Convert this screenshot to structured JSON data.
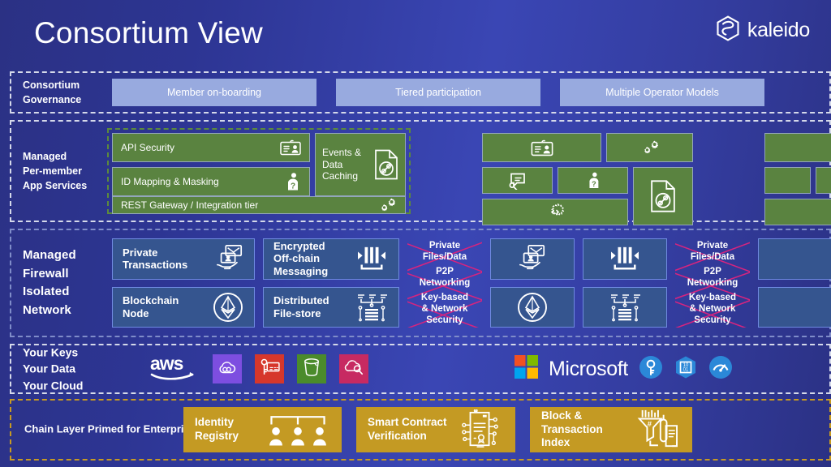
{
  "header": {
    "title": "Consortium View",
    "logo_text": "kaleido",
    "logo_icon": "kaleido-hexagon-icon"
  },
  "bands": {
    "governance": {
      "label": "Consortium\nGovernance",
      "chips": [
        {
          "label": "Member on-boarding"
        },
        {
          "label": "Tiered participation"
        },
        {
          "label": "Multiple Operator Models"
        }
      ],
      "chip_color": "#98aadf",
      "border_color": "#d5d9ea"
    },
    "app_services": {
      "label": "Managed\nPer-member\nApp Services",
      "border_color": "#5c8a3c",
      "card_color": "#5a8340",
      "member1": {
        "services": [
          {
            "label": "API Security",
            "icon": "id-badge-icon"
          },
          {
            "label": "ID Mapping & Masking",
            "icon": "person-key-icon"
          },
          {
            "label": "REST Gateway / Integration tier",
            "icon": "gears-icon"
          }
        ],
        "events": {
          "label": "Events &\nData\nCaching",
          "icon": "document-link-icon"
        }
      },
      "member2": {
        "tiles": [
          {
            "icon": "id-badge-icon"
          },
          {
            "icon": "gears-icon"
          },
          {
            "icon": "chat-key-icon"
          },
          {
            "icon": "person-key-icon"
          },
          {
            "icon": "gear-code-icon"
          },
          {
            "icon": "document-link-icon"
          }
        ]
      },
      "member3": {
        "tiles": [
          {
            "icon": "blank"
          },
          {
            "icon": "blank"
          },
          {
            "icon": "blank"
          },
          {
            "icon": "blank"
          }
        ]
      }
    },
    "firewall": {
      "label": "Managed\nFirewall\nIsolated\nNetwork",
      "border_color": "#7f8cc9",
      "card_color": "#35558f",
      "member1": [
        {
          "label": "Private\nTransactions",
          "icon": "private-transaction-icon"
        },
        {
          "label": "Blockchain\nNode",
          "icon": "ethereum-icon"
        },
        {
          "label": "Encrypted\nOff-chain\nMessaging",
          "icon": "barcode-messaging-icon"
        },
        {
          "label": "Distributed\nFile-store",
          "icon": "file-store-icon"
        }
      ],
      "crossed_out": {
        "lines": "Private\nFiles/Data",
        "lines2": "P2P\nNetworking",
        "lines3": "Key-based\n& Network\nSecurity",
        "strike_color": "#d6247f"
      },
      "member2": [
        {
          "icon": "private-transaction-icon"
        },
        {
          "icon": "ethereum-icon"
        },
        {
          "icon": "barcode-messaging-icon"
        },
        {
          "icon": "file-store-icon"
        }
      ]
    },
    "cloud": {
      "label": "Your Keys\nYour Data\nYour Cloud",
      "border_color": "#d5d9ea",
      "aws": {
        "wordmark": "aws",
        "tiles": [
          {
            "icon": "cloud-link-icon",
            "color": "#7d4ee0"
          },
          {
            "icon": "key-card-icon",
            "color": "#d6372b"
          },
          {
            "icon": "bucket-icon",
            "color": "#4b8b2b"
          },
          {
            "icon": "cloud-search-icon",
            "color": "#c72a62"
          }
        ]
      },
      "microsoft": {
        "wordmark": "Microsoft",
        "logo_colors": [
          "#f25022",
          "#7fba00",
          "#00a4ef",
          "#ffb900"
        ],
        "tiles": [
          {
            "icon": "azure-key-vault-icon",
            "color": "#2b88d8"
          },
          {
            "icon": "azure-blockchain-icon",
            "color": "#2b88d8"
          },
          {
            "icon": "azure-monitor-icon",
            "color": "#2b88d8"
          }
        ]
      }
    },
    "chain": {
      "label": "Chain Layer Primed for\nEnterprise Projects",
      "border_color": "#c79a22",
      "card_color": "#c49a23",
      "cards": [
        {
          "label": "Identity\nRegistry",
          "icon": "identity-registry-icon"
        },
        {
          "label": "Smart Contract\nVerification",
          "icon": "smart-contract-icon"
        },
        {
          "label": "Block &\nTransaction\nIndex",
          "icon": "block-index-icon"
        }
      ]
    }
  }
}
